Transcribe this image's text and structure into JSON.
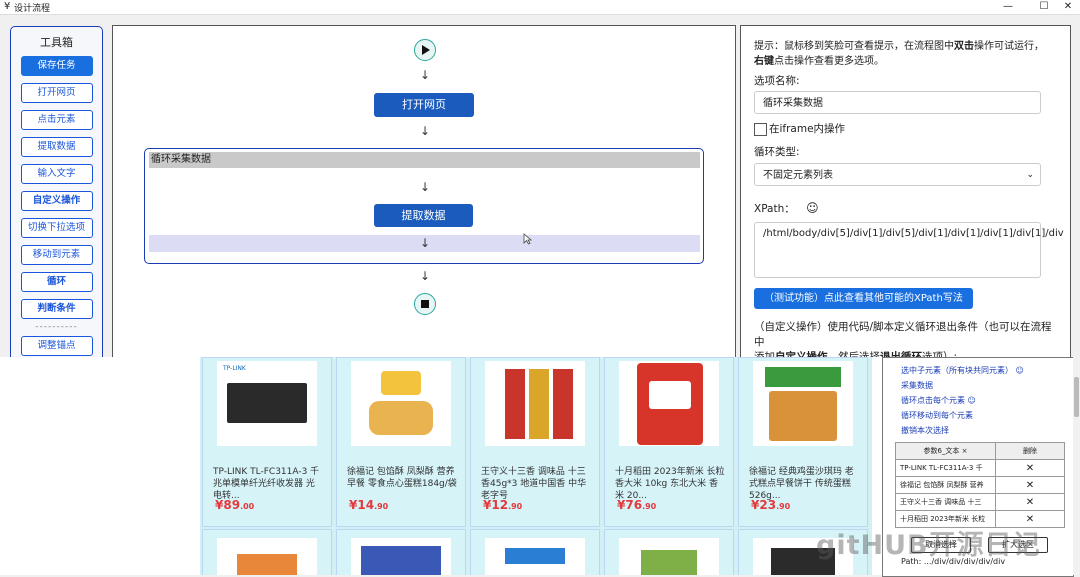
{
  "window": {
    "title": "设计流程",
    "app_icon": "¥",
    "min": "—",
    "max": "☐",
    "close": "✕"
  },
  "toolbox": {
    "title": "工具箱",
    "buttons": [
      "保存任务",
      "打开网页",
      "点击元素",
      "提取数据",
      "输入文字",
      "自定义操作",
      "切换下拉选项",
      "移动到元素",
      "循环",
      "判断条件"
    ],
    "separator": "----------",
    "extra": [
      "调整锚点"
    ]
  },
  "flow": {
    "open_page": "打开网页",
    "loop_title": "循环采集数据",
    "extract": "提取数据",
    "arrow": "↓"
  },
  "props": {
    "hint_prefix": "提示：鼠标移到笑脸可查看提示，在流程图中",
    "hint_dbl": "双击",
    "hint_mid": "操作可试运行，",
    "hint_right": "右键",
    "hint_suffix": "点击操作查看更多选项。",
    "name_label": "选项名称:",
    "name_value": "循环采集数据",
    "iframe_label": "在iframe内操作",
    "type_label": "循环类型:",
    "type_value": "不固定元素列表",
    "xpath_label": "XPath：",
    "xpath_value": "/html/body/div[5]/div[1]/div[5]/div[1]/div[1]/div[1]/div[1]/div",
    "test_btn": "（测试功能）点此查看其他可能的XPath写法",
    "custom_1": "（自定义操作）使用代码/脚本定义循环退出条件（也可以在流程中",
    "custom_2": "添加",
    "custom_3": "自定义操作",
    "custom_4": "，然后选择",
    "custom_5": "退出循环",
    "custom_6": "选项）:"
  },
  "products": [
    {
      "name": "TP-LINK TL-FC311A-3 千兆单模单纤光纤收发器 光电转...",
      "price": "¥89",
      "cents": ".00"
    },
    {
      "name": "徐福记 包馅酥 凤梨酥 营养早餐 零食点心蛋糕184g/袋",
      "price": "¥14",
      "cents": ".90"
    },
    {
      "name": "王守义十三香 调味品 十三香45g*3 地道中国香 中华老字号",
      "price": "¥12",
      "cents": ".90"
    },
    {
      "name": "十月稻田 2023年新米 长粒香大米 10kg 东北大米 香米 20...",
      "price": "¥76",
      "cents": ".90"
    },
    {
      "name": "徐福记 经典鸡蛋沙琪玛 老式糕点早餐饼干 传统蛋糕526g...",
      "price": "¥23",
      "cents": ".90"
    }
  ],
  "panel": {
    "links": [
      "选中子元素（所有块共同元素）",
      "采集数据",
      "循环点击每个元素",
      "循环移动到每个元素",
      "撤销本次选择"
    ],
    "table_headers": [
      "参数6_文本 ×",
      "删除"
    ],
    "rows": [
      "TP-LINK TL-FC311A-3 千",
      "徐福记 包馅酥 凤梨酥 营养",
      "王守义十三香 调味品 十三",
      "十月稻田 2023年新米 长粒"
    ],
    "delete_mark": "✕",
    "cancel_btn": "取消选择",
    "expand_btn": "扩大选区",
    "path": "Path: .../div/div/div/div/div"
  },
  "watermark": "gitHUB开源日记"
}
